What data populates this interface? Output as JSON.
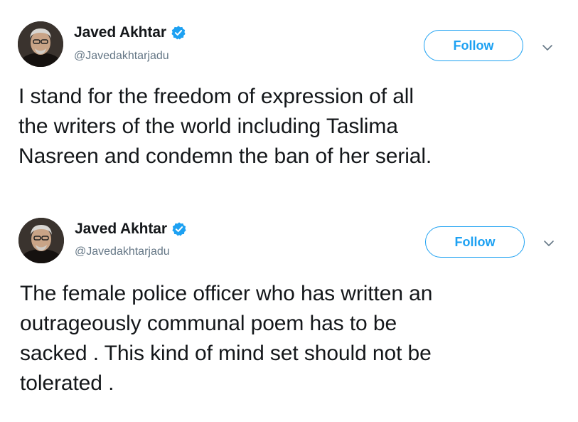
{
  "tweets": [
    {
      "display_name": "Javed Akhtar",
      "handle": "@Javedakhtarjadu",
      "follow_label": "Follow",
      "verified_icon": "verified-badge-icon",
      "text_lines": [
        "I stand for the freedom of expression of all",
        "the writers of the world including Taslima",
        "Nasreen and condemn the ban of her serial."
      ]
    },
    {
      "display_name": "Javed Akhtar",
      "handle": "@Javedakhtarjadu",
      "follow_label": "Follow",
      "verified_icon": "verified-badge-icon",
      "text_lines": [
        "The female police officer who has written an",
        "outrageously communal poem has to be",
        "sacked . This kind of mind set should not be",
        "tolerated ."
      ]
    }
  ],
  "colors": {
    "accent": "#1da1f2",
    "text": "#14171a",
    "handle": "#657786",
    "caret": "#657786"
  }
}
